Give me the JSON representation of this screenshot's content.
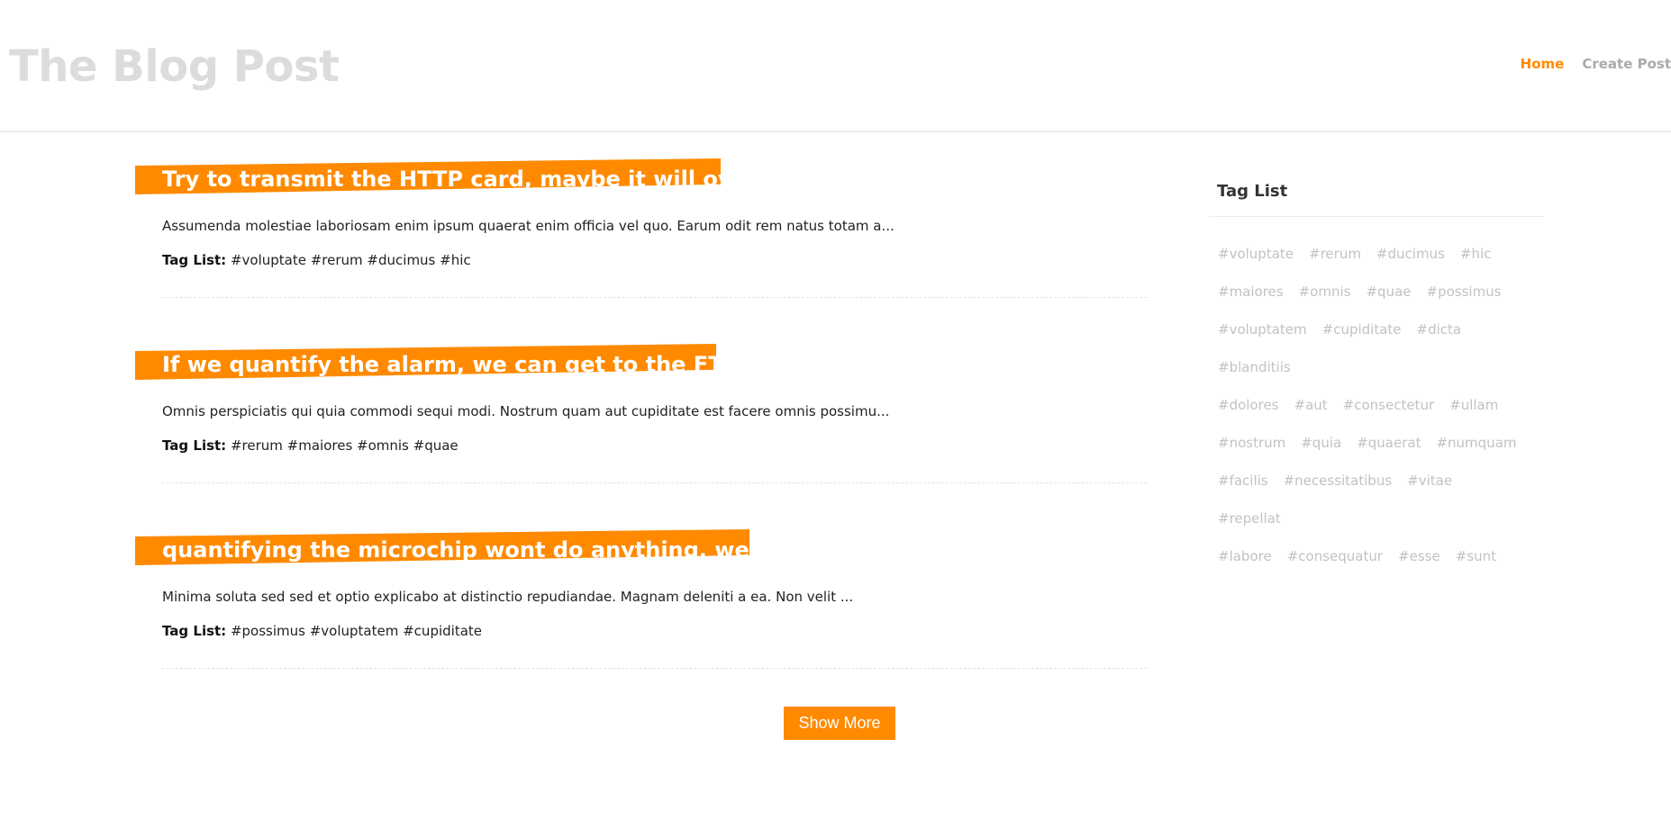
{
  "header": {
    "site_title": "The Blog Post",
    "nav": [
      {
        "label": "Home",
        "active": true
      },
      {
        "label": "Create Post",
        "active": false
      }
    ]
  },
  "posts": [
    {
      "title": "Try to transmit the HTTP card, maybe it will overr",
      "excerpt": "Assumenda molestiae laboriosam enim ipsum quaerat enim officia vel quo. Earum odit rem natus totam a...",
      "tag_label": "Tag List:",
      "tags": "#voluptate #rerum #ducimus #hic"
    },
    {
      "title": "If we quantify the alarm, we can get to the FTP pi",
      "excerpt": "Omnis perspiciatis qui quia commodi sequi modi. Nostrum quam aut cupiditate est facere omnis possimu...",
      "tag_label": "Tag List:",
      "tags": "#rerum #maiores #omnis #quae"
    },
    {
      "title": "quantifying the microchip wont do anything, we nee",
      "excerpt": "Minima soluta sed sed et optio explicabo at distinctio repudiandae. Magnam deleniti a ea. Non velit ...",
      "tag_label": "Tag List:",
      "tags": "#possimus #voluptatem #cupiditate"
    }
  ],
  "show_more_label": "Show More",
  "sidebar": {
    "title": "Tag List",
    "tags": [
      "#voluptate",
      "#rerum",
      "#ducimus",
      "#hic",
      "#maiores",
      "#omnis",
      "#quae",
      "#possimus",
      "#voluptatem",
      "#cupiditate",
      "#dicta",
      "#blanditiis",
      "#dolores",
      "#aut",
      "#consectetur",
      "#ullam",
      "#nostrum",
      "#quia",
      "#quaerat",
      "#numquam",
      "#facilis",
      "#necessitatibus",
      "#vitae",
      "#repellat",
      "#labore",
      "#consequatur",
      "#esse",
      "#sunt"
    ]
  },
  "colors": {
    "accent": "#ff8a00",
    "muted_title": "#dcdcdc",
    "nav_inactive": "#aaaaaa",
    "tag_muted": "#c2c2c2"
  }
}
